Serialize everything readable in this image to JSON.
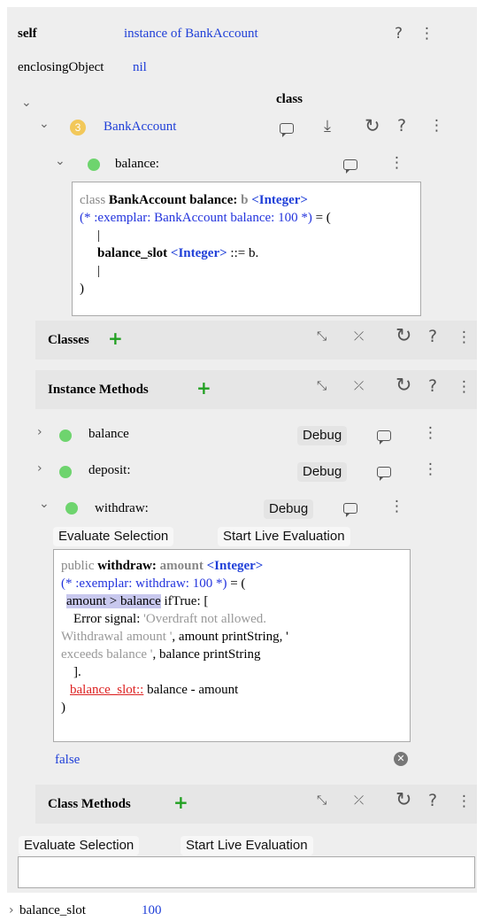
{
  "header": {
    "self_label": "self",
    "self_value": "instance of BankAccount",
    "enclosing_label": "enclosingObject",
    "enclosing_value": "nil",
    "class_label": "class"
  },
  "class_row": {
    "badge": "3",
    "name": "BankAccount"
  },
  "balance_setter": {
    "name": "balance:"
  },
  "setter_code": {
    "l1_a": "class ",
    "l1_b": "BankAccount balance: ",
    "l1_c": "b ",
    "l1_d": "<Integer>",
    "l2": "(* :exemplar: BankAccount balance: 100 *)",
    "l2_b": " = (",
    "l3": "|",
    "l4_a": "balance_slot ",
    "l4_b": "<Integer>",
    "l4_c": " ::= b.",
    "l5": "|",
    "l6": ")"
  },
  "sections": {
    "classes": "Classes",
    "instance_methods": "Instance Methods",
    "class_methods": "Class Methods"
  },
  "methods": [
    {
      "name": "balance",
      "debug": "Debug"
    },
    {
      "name": "deposit:",
      "debug": "Debug"
    },
    {
      "name": "withdraw:",
      "debug": "Debug"
    }
  ],
  "eval_buttons": {
    "evaluate": "Evaluate Selection",
    "live": "Start Live Evaluation"
  },
  "withdraw_code": {
    "l1_a": "public ",
    "l1_b": "withdraw: ",
    "l1_c": "amount ",
    "l1_d": "<Integer>",
    "l2": "(* :exemplar: withdraw: 100 *)",
    "l2_b": " = (",
    "l3_hl": "amount > balance",
    "l3_b": " ifTrue: [",
    "l4_a": "Error signal: ",
    "l4_b": "'Overdraft not allowed.",
    "l5_a": "Withdrawal amount '",
    "l5_b": ", amount printString, '",
    "l6_a": "exceeds balance '",
    "l6_b": ", balance printString",
    "l7": "].",
    "l8_err": "balance_slot::",
    "l8_b": " balance - amount",
    "l9": ")"
  },
  "result": {
    "value": "false"
  },
  "footer": {
    "slot_name": "balance_slot",
    "slot_value": "100"
  }
}
